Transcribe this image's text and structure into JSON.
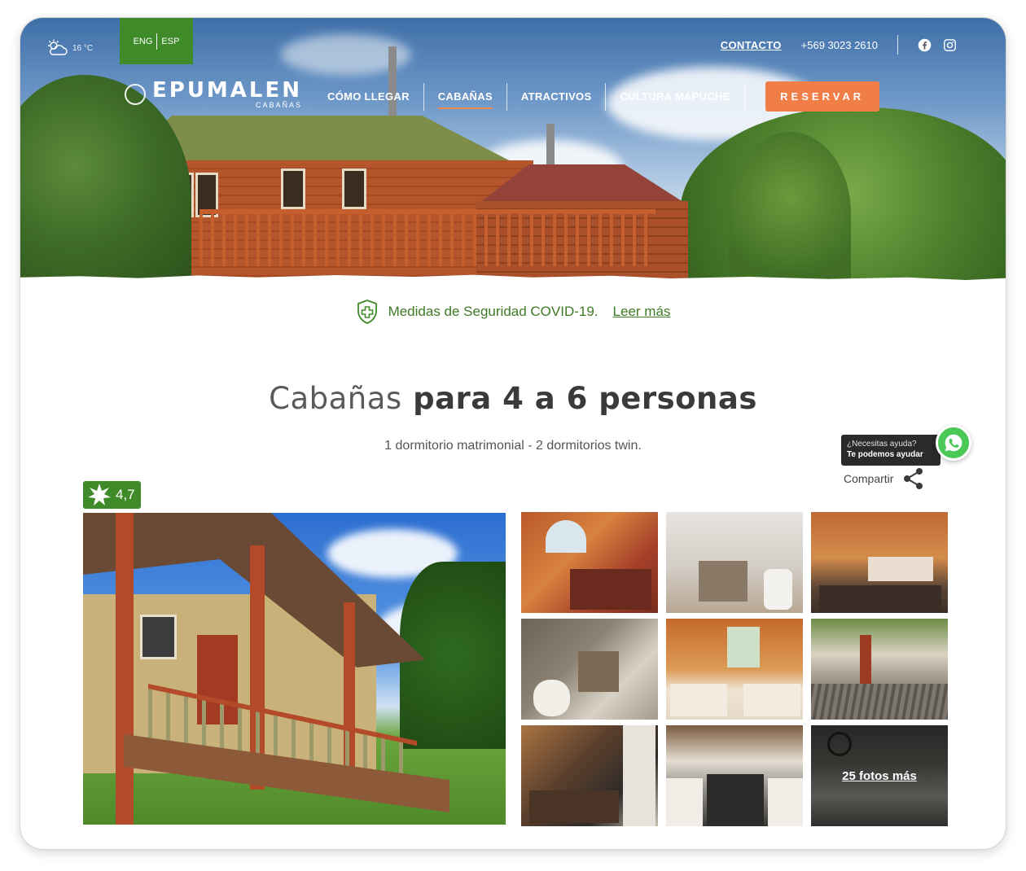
{
  "header": {
    "weather": {
      "icon": "partly-cloudy-icon",
      "temperature": "16 °C"
    },
    "language": {
      "options": [
        "ENG",
        "ESP"
      ]
    },
    "contact_label": "CONTACTO",
    "phone": "+569 3023 2610",
    "social": [
      "facebook-icon",
      "instagram-icon"
    ],
    "logo": {
      "name": "EPUMALEN",
      "sub": "CABAÑAS"
    },
    "nav": [
      "CÓMO LLEGAR",
      "CABAÑAS",
      "ATRACTIVOS",
      "CULTURA MAPUCHE"
    ],
    "nav_active": "CABAÑAS",
    "reserve_label": "RESERVAR"
  },
  "covid": {
    "icon": "shield-plus-icon",
    "text": "Medidas de Seguridad COVID-19.",
    "link": "Leer más"
  },
  "page": {
    "title_light": "Cabañas",
    "title_bold": "para 4 a 6 personas",
    "subtitle": "1 dormitorio matrimonial - 2 dormitorios twin."
  },
  "help": {
    "question": "¿Necesitas ayuda?",
    "answer": "Te podemos ayudar",
    "icon": "whatsapp-icon"
  },
  "share": {
    "label": "Compartir",
    "icon": "share-icon"
  },
  "rating": {
    "icon": "star-burst-icon",
    "value": "4,7"
  },
  "gallery": {
    "more_label": "25 fotos más"
  },
  "colors": {
    "green": "#3f8a29",
    "orange": "#f07e46",
    "text": "#3a3a3a"
  }
}
